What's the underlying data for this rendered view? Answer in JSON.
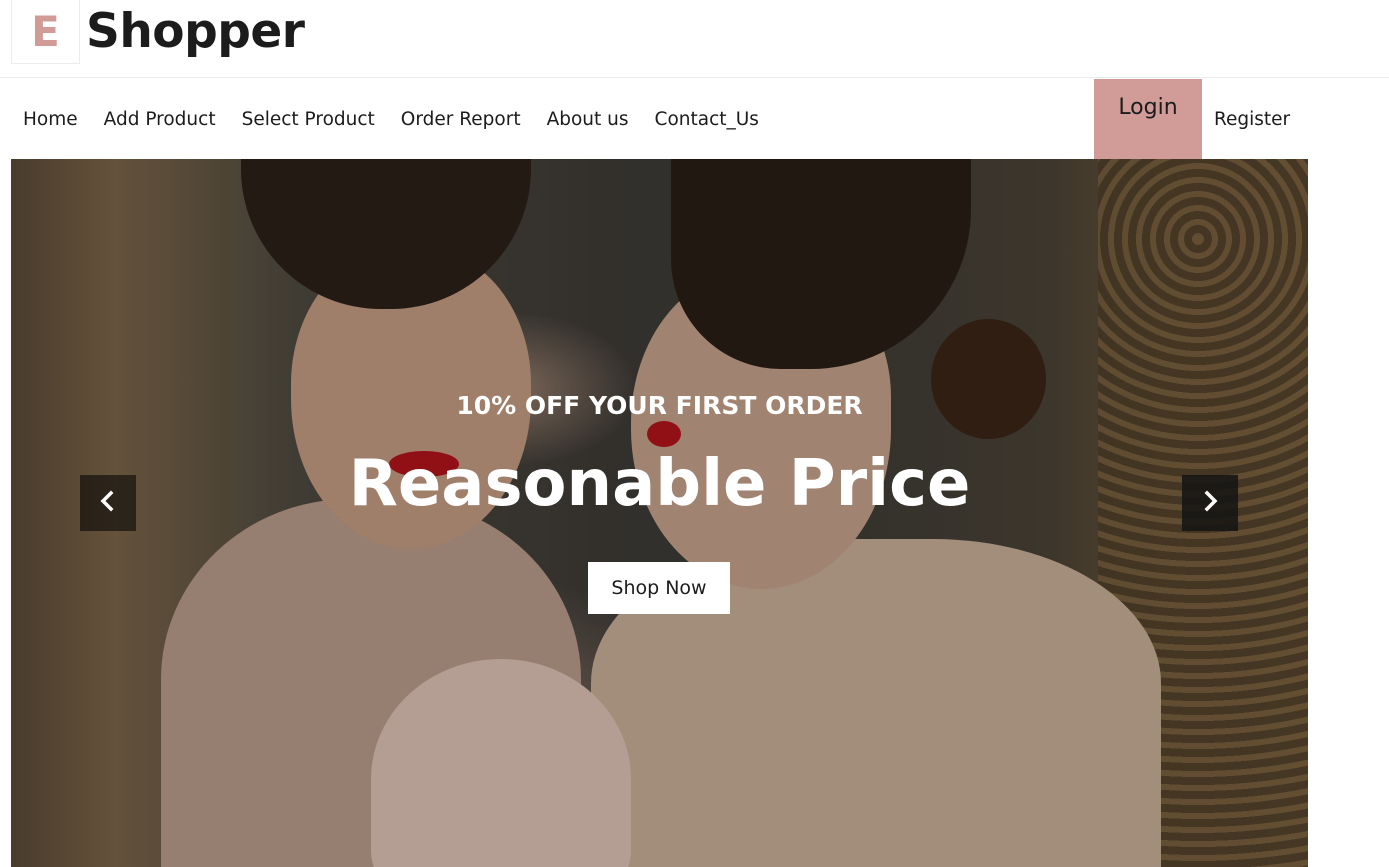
{
  "brand": {
    "mark": "E",
    "name": "Shopper",
    "accent_color": "#d19c97"
  },
  "nav": {
    "links": [
      "Home",
      "Add Product",
      "Select Product",
      "Order Report",
      "About us",
      "Contact_Us"
    ],
    "login_label": "Login",
    "register_label": "Register"
  },
  "hero": {
    "kicker": "10% OFF YOUR FIRST ORDER",
    "title": "Reasonable Price",
    "cta_label": "Shop Now",
    "prev_icon": "chevron-left-icon",
    "next_icon": "chevron-right-icon"
  }
}
